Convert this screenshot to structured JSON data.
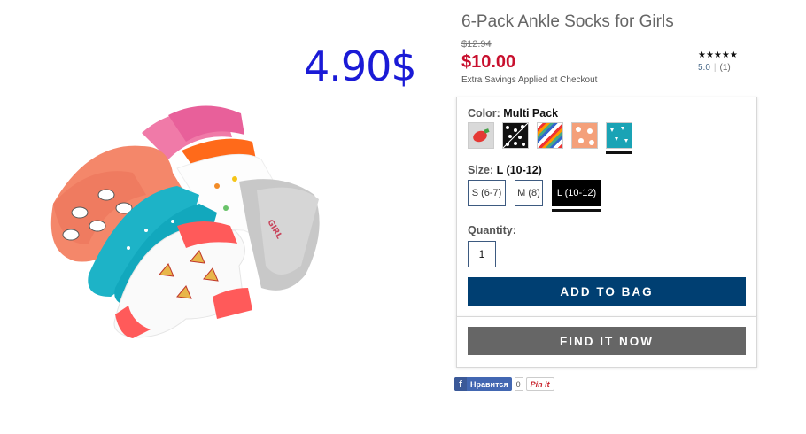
{
  "overlay_price": "4.90$",
  "product": {
    "title": "6-Pack Ankle Socks for Girls",
    "original_price": "$12.94",
    "sale_price": "$10.00",
    "savings_note": "Extra Savings Applied at Checkout",
    "sale_color": "#c8102e"
  },
  "rating": {
    "stars": "★★★★★",
    "score": "5.0",
    "count": "(1)",
    "value": 5
  },
  "color_option": {
    "label": "Color:",
    "selected": "Multi Pack",
    "swatches": [
      "strawberry",
      "black-dots",
      "rainbow-stripes",
      "peach-dots",
      "teal-triangles"
    ]
  },
  "size_option": {
    "label": "Size:",
    "selected": "L (10-12)",
    "options": [
      "S (6-7)",
      "M (8)",
      "L (10-12)"
    ]
  },
  "quantity": {
    "label": "Quantity:",
    "value": "1"
  },
  "buttons": {
    "add_to_bag": "ADD TO BAG",
    "find_it_now": "FIND IT NOW",
    "primary_color": "#003f72",
    "secondary_color": "#666666"
  },
  "social": {
    "facebook_label": "Нравится",
    "facebook_icon": "f",
    "facebook_count": "0",
    "pinterest_label": "Pin it"
  }
}
